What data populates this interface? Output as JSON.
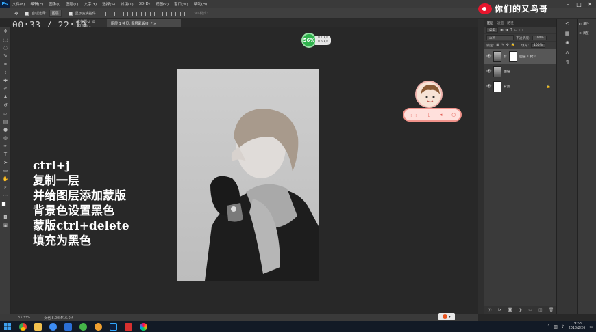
{
  "app": {
    "logo": "Ps",
    "menu": [
      "文件(F)",
      "编辑(E)",
      "图像(I)",
      "图层(L)",
      "文字(Y)",
      "选择(S)",
      "滤镜(T)",
      "3D(D)",
      "视图(V)",
      "窗口(W)",
      "帮助(H)"
    ],
    "window_controls": [
      "–",
      "□",
      "✕"
    ]
  },
  "options_bar": {
    "auto_select_label": "自动选择:",
    "auto_select_value": "图层",
    "transform_label": "显示变换控件",
    "mode_3d_label": "3D 模式:"
  },
  "overlay": {
    "timer": "00:33 / 22:19",
    "watermark": "你们的又鸟哥",
    "net_percent": "56%",
    "net_up": "0.1 K/s",
    "net_down": "0.6 K/s"
  },
  "tabs": [
    {
      "label": "未标题-2 @ 33.3%..."
    },
    {
      "label": "图层 1 拷贝, 图层蒙版/8) *  ×"
    }
  ],
  "annotation": [
    "ctrl+j",
    "复制一层",
    "并给图层添加蒙版",
    "背景色设置黑色",
    "蒙版ctrl+delete",
    "填充为黑色"
  ],
  "layers_panel": {
    "tabs": [
      "图层",
      "通道",
      "路径"
    ],
    "kind_label": "类型",
    "blend_mode": "正常",
    "opacity_label": "不透明度:",
    "opacity_value": "100%",
    "lock_label": "锁定:",
    "fill_label": "填充:",
    "fill_value": "100%",
    "layers": [
      {
        "name": "图层 1 拷贝",
        "selected": true
      },
      {
        "name": "图层 1",
        "selected": false
      },
      {
        "name": "背景",
        "selected": false
      }
    ],
    "footer_icons": [
      "ⓕ",
      "fx",
      "◙",
      "◑",
      "▭",
      "◫",
      "🗑"
    ]
  },
  "properties_panel": {
    "items": [
      {
        "icon": "◧",
        "label": "属性"
      },
      {
        "icon": "⊘",
        "label": "调整"
      }
    ]
  },
  "status": {
    "zoom": "33.33%",
    "doc": "文档:8.00M/16.0M"
  },
  "taskbar": {
    "time": "19:53",
    "date": "2018/2/26"
  }
}
